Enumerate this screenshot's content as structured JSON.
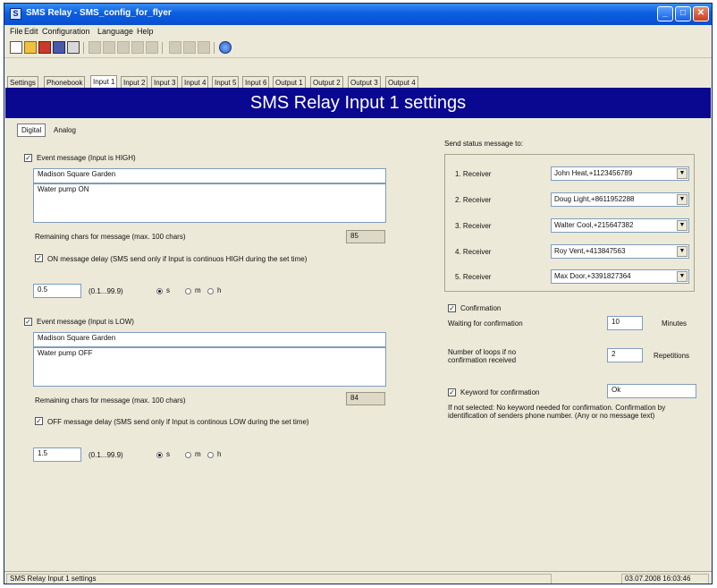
{
  "window": {
    "title": "SMS Relay - SMS_config_for_flyer"
  },
  "menu": [
    "File",
    "Edit",
    "Configuration",
    "Language",
    "Help"
  ],
  "tabs": [
    "Settings",
    "Phonebook",
    "Input 1",
    "Input 2",
    "Input 3",
    "Input 4",
    "Input 5",
    "Input 6",
    "Output 1",
    "Output 2",
    "Output 3",
    "Output 4"
  ],
  "header": {
    "title": "SMS Relay Input 1 settings"
  },
  "subtabs": [
    "Digital",
    "Analog"
  ],
  "high": {
    "checkbox_label": "Event message (Input is HIGH)",
    "line1": "Madison Square Garden",
    "line2": "Water pump ON",
    "remaining_label": "Remaining chars for message  (max. 100 chars)",
    "remaining_value": "85",
    "delay_label": "ON message delay (SMS send only if Input is continuos HIGH during the set time)",
    "delay_value": "0.5",
    "range": "(0.1...99.9)"
  },
  "low": {
    "checkbox_label": "Event message (Input is LOW)",
    "line1": "Madison Square Garden",
    "line2": "Water pump OFF",
    "remaining_label": "Remaining chars for message  (max. 100 chars)",
    "remaining_value": "84",
    "delay_label": "OFF message delay (SMS send only if Input is continous  LOW during the set time)",
    "delay_value": "1.5",
    "range": "(0.1...99.9)"
  },
  "units": {
    "s": "s",
    "m": "m",
    "h": "h"
  },
  "send_status_label": "Send status message to:",
  "receivers": [
    {
      "label": "1. Receiver",
      "value": "John Heat,+1123456789"
    },
    {
      "label": "2. Receiver",
      "value": "Doug Light,+8611952288"
    },
    {
      "label": "3. Receiver",
      "value": "Walter Cool,+215647382"
    },
    {
      "label": "4. Receiver",
      "value": "Roy Vent,+413847563"
    },
    {
      "label": "5. Receiver",
      "value": "Max Door,+3391827364"
    }
  ],
  "confirmation": {
    "label": "Confirmation",
    "waiting_label": "Waiting for confirmation",
    "waiting_value": "10",
    "waiting_unit": "Minutes",
    "loops_label": "Number of loops if no confirmation received",
    "loops_value": "2",
    "loops_unit": "Repetitions",
    "keyword_label": "Keyword for confirmation",
    "keyword_value": "Ok",
    "note": "If not selected: No keyword needed for confirmation.  Confirmation by identification of senders phone number. (Any or no message text)"
  },
  "status": {
    "left": "SMS Relay Input 1 settings",
    "right": "03.07.2008 16:03:46"
  }
}
